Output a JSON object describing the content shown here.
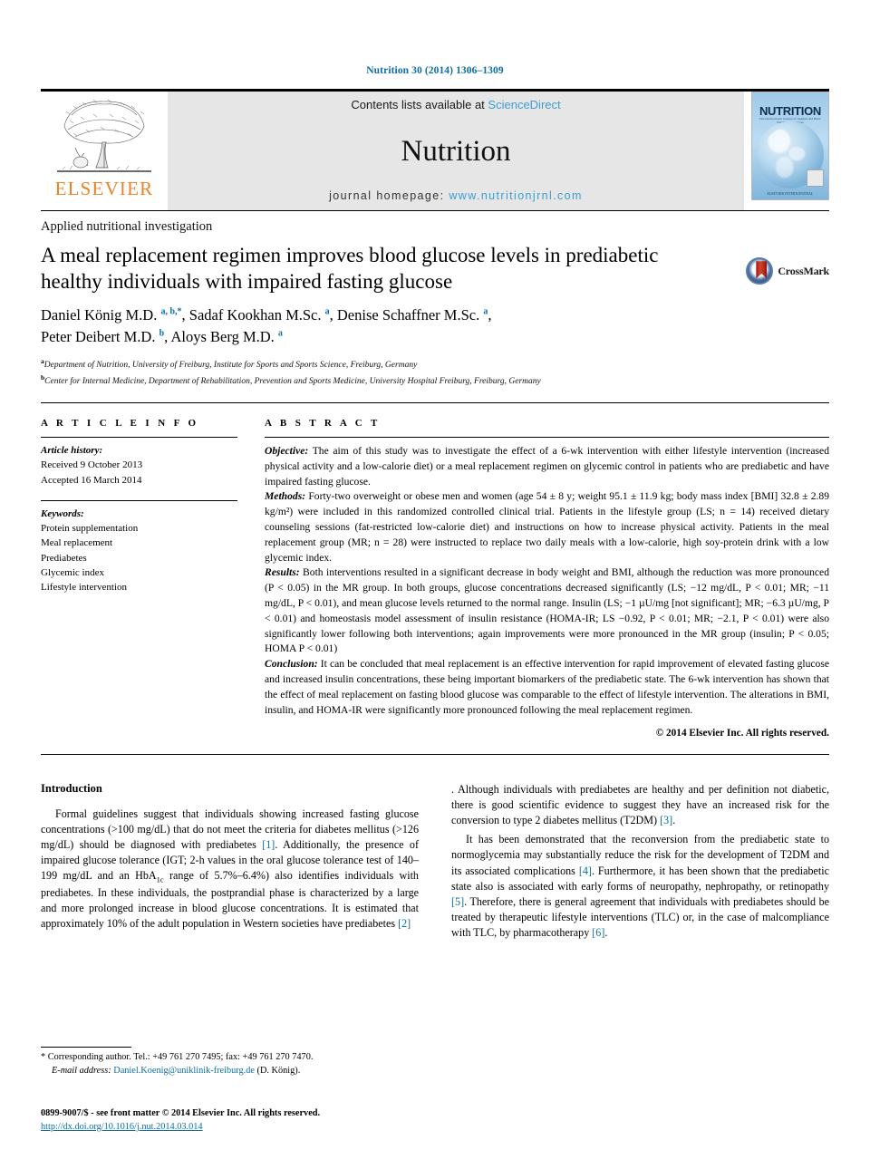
{
  "running_head": "Nutrition 30 (2014) 1306–1309",
  "masthead": {
    "publisher_name": "ELSEVIER",
    "contents_prefix": "Contents lists available at",
    "contents_link": "ScienceDirect",
    "journal_title": "Nutrition",
    "homepage_prefix": "journal homepage:",
    "homepage_link": "www.nutritionjrnl.com",
    "cover_title": "NUTRITION",
    "cover_subtitle": "The International Journal of Applied and Basic Nutritional Sciences",
    "cover_footer": "ELSEVIER INTERNATIONAL"
  },
  "article": {
    "section_label": "Applied nutritional investigation",
    "title": "A meal replacement regimen improves blood glucose levels in prediabetic healthy individuals with impaired fasting glucose",
    "crossmark_label": "CrossMark",
    "authors_line1": "Daniel König M.D. <sup>a, b,</sup><sup>*</sup>, Sadaf Kookhan M.Sc. <sup>a</sup>, Denise Schaffner M.Sc. <sup>a</sup>,",
    "authors_line2": "Peter Deibert M.D. <sup>b</sup>, Aloys Berg M.D. <sup>a</sup>",
    "affiliation_a": "Department of Nutrition, University of Freiburg, Institute for Sports and Sports Science, Freiburg, Germany",
    "affiliation_b": "Center for Internal Medicine, Department of Rehabilitation, Prevention and Sports Medicine, University Hospital Freiburg, Freiburg, Germany"
  },
  "article_info": {
    "heading": "A R T I C L E  I N F O",
    "history_label": "Article history:",
    "received": "Received 9 October 2013",
    "accepted": "Accepted 16 March 2014",
    "keywords_label": "Keywords:",
    "keywords": [
      "Protein supplementation",
      "Meal replacement",
      "Prediabetes",
      "Glycemic index",
      "Lifestyle intervention"
    ]
  },
  "abstract": {
    "heading": "A B S T R A C T",
    "objective_label": "Objective:",
    "objective_text": " The aim of this study was to investigate the effect of a 6-wk intervention with either lifestyle intervention (increased physical activity and a low-calorie diet) or a meal replacement regimen on glycemic control in patients who are prediabetic and have impaired fasting glucose.",
    "methods_label": "Methods:",
    "methods_text": " Forty-two overweight or obese men and women (age 54 ± 8 y; weight 95.1 ± 11.9 kg; body mass index [BMI] 32.8 ± 2.89 kg/m²) were included in this randomized controlled clinical trial. Patients in the lifestyle group (LS; n = 14) received dietary counseling sessions (fat-restricted low-calorie diet) and instructions on how to increase physical activity. Patients in the meal replacement group (MR; n = 28) were instructed to replace two daily meals with a low-calorie, high soy-protein drink with a low glycemic index.",
    "results_label": "Results:",
    "results_text": " Both interventions resulted in a significant decrease in body weight and BMI, although the reduction was more pronounced (P < 0.05) in the MR group. In both groups, glucose concentrations decreased significantly (LS; −12 mg/dL, P < 0.01; MR; −11 mg/dL, P < 0.01), and mean glucose levels returned to the normal range. Insulin (LS; −1 µU/mg [not significant]; MR; −6.3 µU/mg, P < 0.01) and homeostasis model assessment of insulin resistance (HOMA-IR; LS −0.92, P < 0.01; MR; −2.1, P < 0.01) were also significantly lower following both interventions; again improvements were more pronounced in the MR group (insulin; P < 0.05; HOMA P < 0.01)",
    "conclusion_label": "Conclusion:",
    "conclusion_text": " It can be concluded that meal replacement is an effective intervention for rapid improvement of elevated fasting glucose and increased insulin concentrations, these being important biomarkers of the prediabetic state. The 6-wk intervention has shown that the effect of meal replacement on fasting blood glucose was comparable to the effect of lifestyle intervention. The alterations in BMI, insulin, and HOMA-IR were significantly more pronounced following the meal replacement regimen.",
    "copyright": "© 2014 Elsevier Inc. All rights reserved."
  },
  "introduction": {
    "heading": "Introduction",
    "para1_a": "Formal guidelines suggest that individuals showing increased fasting glucose concentrations (>100 mg/dL) that do not meet the criteria for diabetes mellitus (>126 mg/dL) should be diagnosed with prediabetes ",
    "para1_ref1": "[1]",
    "para1_b": ". Additionally, the presence of impaired glucose tolerance (IGT; 2-h values in the oral glucose tolerance test of 140–199 mg/dL and an HbA",
    "para1_sub": "1c",
    "para1_c": " range of 5.7%–6.4%) also identifies individuals with prediabetes. In these individuals, the postprandial phase is characterized by a large and more prolonged increase in blood glucose concentrations. It is estimated that approximately 10% of the adult population in Western societies have prediabetes ",
    "para1_ref2": "[2]",
    "para1_d": ". Although individuals with prediabetes are healthy and per definition not diabetic, there is good scientific evidence to suggest they have an increased risk for the conversion to type 2 diabetes mellitus (T2DM) ",
    "para1_ref3": "[3]",
    "para1_e": ".",
    "para2_a": "It has been demonstrated that the reconversion from the prediabetic state to normoglycemia may substantially reduce the risk for the development of T2DM and its associated complications ",
    "para2_ref4": "[4]",
    "para2_b": ". Furthermore, it has been shown that the prediabetic state also is associated with early forms of neuropathy, nephropathy, or retinopathy ",
    "para2_ref5": "[5]",
    "para2_c": ". Therefore, there is general agreement that individuals with prediabetes should be treated by therapeutic lifestyle interventions (TLC) or, in the case of malcompliance with TLC, by pharmacotherapy ",
    "para2_ref6": "[6]",
    "para2_d": "."
  },
  "footnote": {
    "corresponding": "* Corresponding author. Tel.: +49 761 270 7495; fax: +49 761 270 7470.",
    "email_label": "E-mail address:",
    "email": "Daniel.Koenig@uniklinik-freiburg.de",
    "email_suffix": " (D. König).",
    "issn_line": "0899-9007/$ - see front matter © 2014 Elsevier Inc. All rights reserved.",
    "doi": "http://dx.doi.org/10.1016/j.nut.2014.03.014"
  },
  "colors": {
    "link_blue": "#0b6ea4",
    "sciencedirect_blue": "#3e9dd1",
    "elsevier_orange": "#ec8223",
    "banner_gray": "#e6e6e6"
  }
}
